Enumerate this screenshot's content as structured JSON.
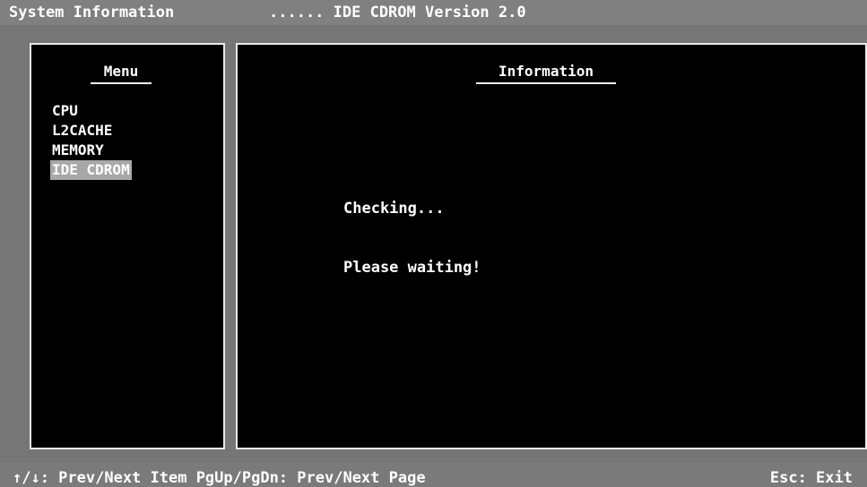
{
  "title_bar": {
    "app_title": "System Information",
    "window_title": "...... IDE CDROM Version 2.0"
  },
  "menu_panel": {
    "header": "Menu",
    "items": [
      {
        "label": "CPU",
        "selected": false
      },
      {
        "label": "L2CACHE",
        "selected": false
      },
      {
        "label": "MEMORY",
        "selected": false
      },
      {
        "label": "IDE CDROM",
        "selected": true
      }
    ]
  },
  "info_panel": {
    "header": "Information",
    "lines": [
      "Checking...",
      "Please waiting!"
    ]
  },
  "status_bar": {
    "navigation_hint": "↑/↓: Prev/Next Item PgUp/PgDn: Prev/Next Page",
    "exit_hint": "Esc: Exit"
  },
  "colors": {
    "background": "#7c7c7c",
    "panel_background": "#000000",
    "panel_border": "#e8e8e8",
    "selection_highlight": "#a8a8a8",
    "text": "#ffffff"
  }
}
